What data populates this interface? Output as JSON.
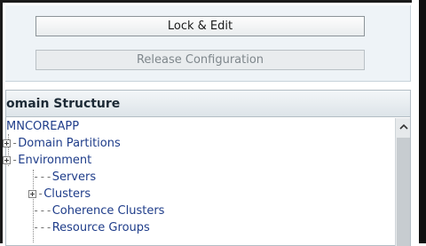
{
  "change_center": {
    "lock_edit_label": "Lock & Edit",
    "release_configuration_label": "Release Configuration"
  },
  "domain_structure": {
    "title": "omain Structure",
    "tree": {
      "root": "MNCOREAPP",
      "domain_partitions": "Domain Partitions",
      "environment": "Environment",
      "servers": "Servers",
      "clusters": "Clusters",
      "coherence_clusters": "Coherence Clusters",
      "resource_groups": "Resource Groups"
    }
  },
  "colors": {
    "link": "#1f3d8a",
    "panel_bg": "#eef3f7",
    "header_text": "#1c2a36"
  },
  "icons": {
    "expand": "plus-box-icon",
    "scroll_up": "chevron-up-icon"
  }
}
